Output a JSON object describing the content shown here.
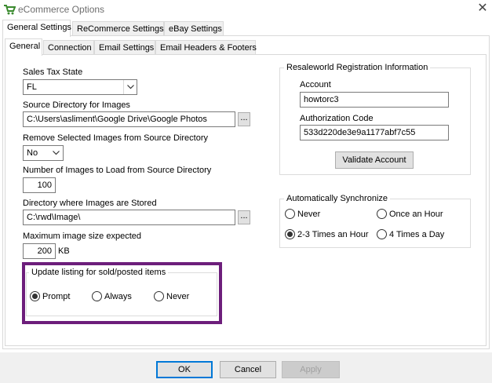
{
  "window": {
    "title": "eCommerce Options",
    "close_glyph": "✕"
  },
  "outer_tabs": [
    {
      "label": "General Settings",
      "active": true
    },
    {
      "label": "ReCommerce Settings",
      "active": false
    },
    {
      "label": "eBay Settings",
      "active": false
    }
  ],
  "inner_tabs": [
    {
      "label": "General",
      "active": true
    },
    {
      "label": "Connection",
      "active": false
    },
    {
      "label": "Email Settings",
      "active": false
    },
    {
      "label": "Email Headers & Footers",
      "active": false
    }
  ],
  "general": {
    "sales_tax_state": {
      "label": "Sales Tax State",
      "value": "FL"
    },
    "source_dir": {
      "label": "Source Directory for Images",
      "value": "C:\\Users\\asliment\\Google Drive\\Google Photos",
      "browse": "..."
    },
    "remove_images": {
      "label": "Remove Selected Images from Source Directory",
      "value": "No"
    },
    "num_images": {
      "label": "Number of Images to Load from Source Directory",
      "value": "100"
    },
    "stored_dir": {
      "label": "Directory where Images are Stored",
      "value": "C:\\rwd\\Image\\",
      "browse": "..."
    },
    "max_size": {
      "label": "Maximum image size expected",
      "value": "200",
      "unit": "KB"
    }
  },
  "update_listing": {
    "title": "Update listing for sold/posted items",
    "options": [
      {
        "label": "Prompt",
        "checked": true
      },
      {
        "label": "Always",
        "checked": false
      },
      {
        "label": "Never",
        "checked": false
      }
    ],
    "highlight_color": "#6d1e7b"
  },
  "registration": {
    "title": "Resaleworld Registration Information",
    "account_label": "Account",
    "account_value": "howtorc3",
    "auth_label": "Authorization Code",
    "auth_value": "533d220de3e9a1177abf7c55",
    "validate_label": "Validate Account"
  },
  "sync": {
    "title": "Automatically Synchronize",
    "options": [
      {
        "label": "Never",
        "checked": false
      },
      {
        "label": "Once an Hour",
        "checked": false
      },
      {
        "label": "2-3 Times an Hour",
        "checked": true
      },
      {
        "label": "4 Times a Day",
        "checked": false
      }
    ]
  },
  "buttons": {
    "ok": "OK",
    "cancel": "Cancel",
    "apply": "Apply"
  },
  "colors": {
    "accent": "#0078d7",
    "icon_green": "#3a8a2e"
  }
}
